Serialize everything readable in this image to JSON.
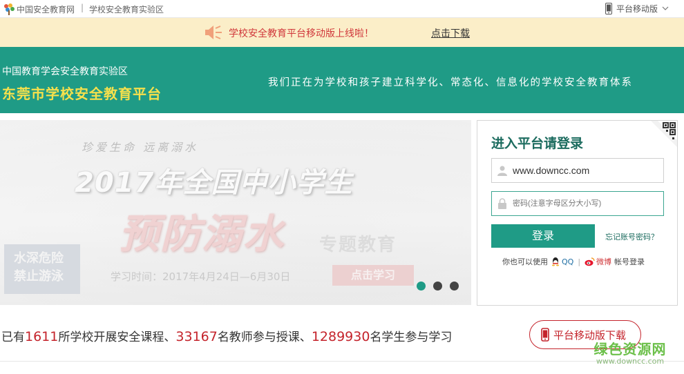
{
  "topbar": {
    "site_name": "中国安全教育网",
    "separator": "|",
    "sub_site": "学校安全教育实验区",
    "mobile_label": "平台移动版"
  },
  "notice": {
    "message": "学校安全教育平台移动版上线啦！",
    "link": "点击下载"
  },
  "header": {
    "org": "中国教育学会安全教育实验区",
    "title": "东莞市学校安全教育平台",
    "slogan": "我们正在为学校和孩子建立科学化、常态化、信息化的学校安全教育体系"
  },
  "banner": {
    "subtitle": "珍爱生命  远离溺水",
    "title": "2017年全国中小学生",
    "topic": "预防溺水",
    "topic_suffix": "专题教育",
    "sign_line1": "水深危险",
    "sign_line2": "禁止游泳",
    "study_time": "学习时间：2017年4月24日—6月30日",
    "cta": "点击学习",
    "active_slide": 1,
    "slide_count": 3
  },
  "login": {
    "title": "进入平台请登录",
    "username_value": "www.downcc.com",
    "password_placeholder": "密码(注意字母区分大小写)",
    "login_button": "登录",
    "forgot": "忘记账号密码？",
    "alt_prefix": "你也可以使用",
    "qq": "QQ",
    "separator": "|",
    "weibo": "微博",
    "alt_suffix": "帐号登录"
  },
  "stats": {
    "prefix": "已有",
    "schools": "1611",
    "mid1": "所学校开展安全课程、",
    "teachers": "33167",
    "mid2": "名教师参与授课、",
    "students": "1289930",
    "suffix": "名学生参与学习"
  },
  "mobile_download": "平台移动版下载",
  "watermark": {
    "line1": "绿色资源网",
    "line2": "www.downcc.com"
  },
  "colors": {
    "teal": "#1f9b86",
    "title_yellow": "#f6e04c",
    "accent_red": "#c4232b",
    "notice_bg": "#fbeec8"
  }
}
